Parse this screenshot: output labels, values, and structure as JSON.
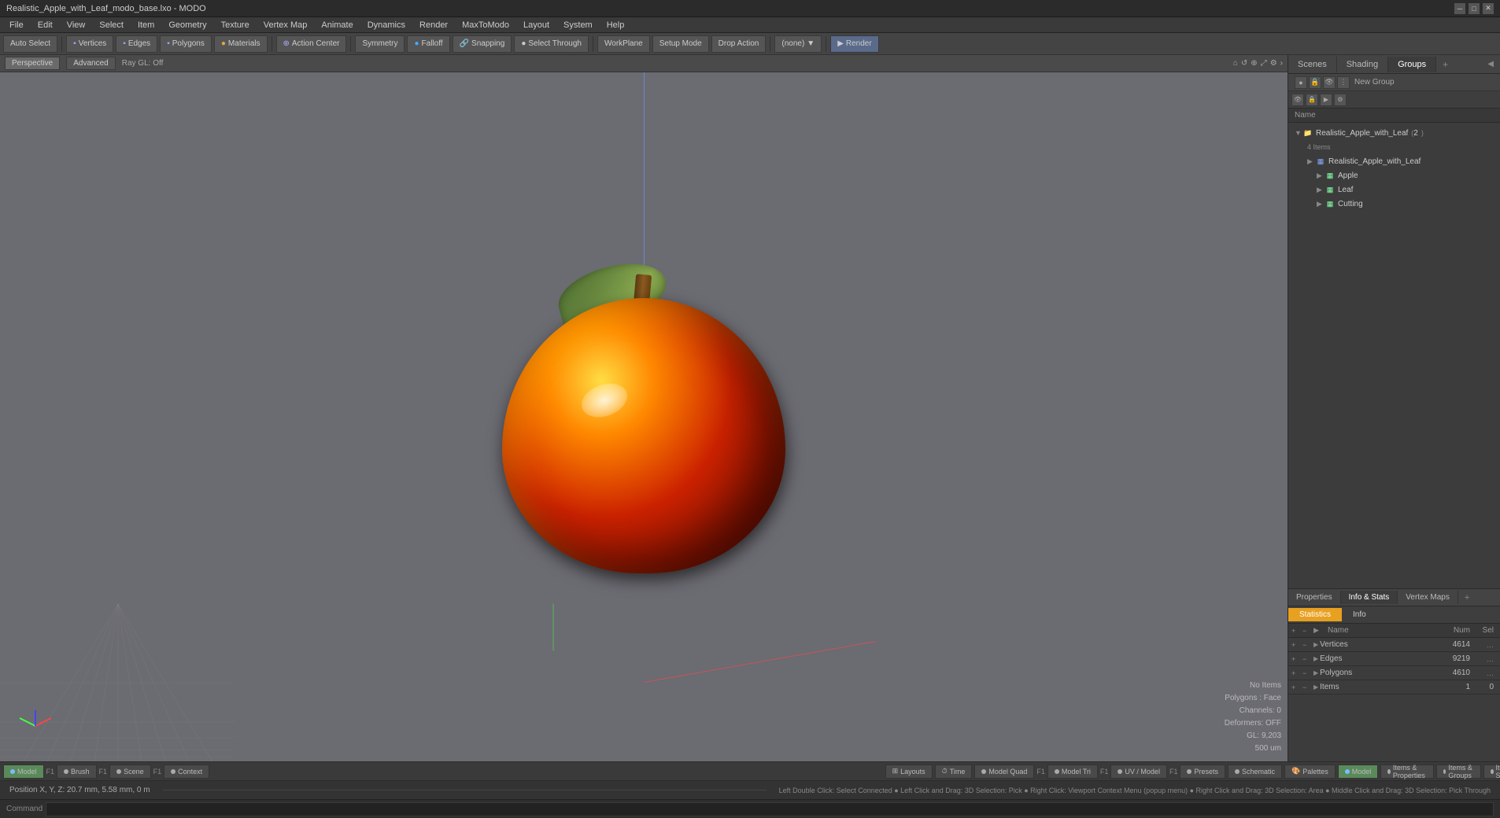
{
  "titlebar": {
    "title": "Realistic_Apple_with_Leaf_modo_base.lxo - MODO",
    "minimize_label": "─",
    "maximize_label": "□",
    "close_label": "✕"
  },
  "menubar": {
    "items": [
      "File",
      "Edit",
      "View",
      "Select",
      "Item",
      "Geometry",
      "Texture",
      "Vertex Map",
      "Animate",
      "Dynamics",
      "Render",
      "MaxToModo",
      "Layout",
      "System",
      "Help"
    ]
  },
  "toolbar": {
    "auto_select": "Auto Select",
    "vertices": "Vertices",
    "edges": "Edges",
    "polygons": "Polygons",
    "materials": "Materials",
    "action_center": "Action Center",
    "symmetry": "Symmetry",
    "falloff": "Falloff",
    "snapping": "Snapping",
    "select_through": "Select Through",
    "workplane": "WorkPlane",
    "setup_mode": "Setup Mode",
    "drop_action": "Drop Action",
    "none_label": "(none)",
    "render": "Render"
  },
  "viewport": {
    "tab_perspective": "Perspective",
    "tab_advanced": "Advanced",
    "ray_gl": "Ray GL: Off",
    "no_items": "No Items",
    "polygons_face": "Polygons : Face",
    "channels_0": "Channels: 0",
    "deformers_off": "Deformers: OFF",
    "gl_9203": "GL: 9,203",
    "size_500um": "500 um"
  },
  "right_panel": {
    "tabs": [
      "Scenes",
      "Shading",
      "Groups"
    ],
    "active_tab": "Groups",
    "add_tab_label": "+",
    "new_group_label": "New Group",
    "name_col_label": "Name",
    "tree": {
      "root_item": "Realistic_Apple_with_Leaf",
      "root_count": "2",
      "root_sub_label": "4 Items",
      "children": [
        {
          "label": "Realistic_Apple_with_Leaf",
          "indent": 1,
          "color": "#88aaff"
        },
        {
          "label": "Apple",
          "indent": 2,
          "color": "#88ffaa"
        },
        {
          "label": "Leaf",
          "indent": 2,
          "color": "#88ffaa"
        },
        {
          "label": "Cutting",
          "indent": 2,
          "color": "#88ffaa"
        }
      ]
    }
  },
  "properties": {
    "tabs": [
      "Properties",
      "Info & Stats",
      "Vertex Maps"
    ],
    "active_tab": "Info & Stats",
    "add_tab_label": "+"
  },
  "statistics": {
    "tabs": [
      "Statistics",
      "Info"
    ],
    "active_tab": "Statistics",
    "col_name": "Name",
    "col_num": "Num",
    "col_sel": "Sel",
    "rows": [
      {
        "name": "Vertices",
        "num": "4614",
        "sel": "…"
      },
      {
        "name": "Edges",
        "num": "9219",
        "sel": "…"
      },
      {
        "name": "Polygons",
        "num": "4610",
        "sel": "…"
      },
      {
        "name": "Items",
        "num": "1",
        "sel": "0"
      }
    ]
  },
  "bottom_view_tabs": {
    "left": [
      {
        "label": "Model",
        "active": true
      },
      {
        "label": "Brush"
      },
      {
        "label": "F1"
      },
      {
        "label": "Scene"
      },
      {
        "label": "F1"
      },
      {
        "label": "Context"
      }
    ],
    "center_label": "Layouts",
    "right": [
      {
        "label": "Time"
      },
      {
        "label": "Model Quad"
      },
      {
        "label": "F1"
      },
      {
        "label": "Model Tri"
      },
      {
        "label": "F1"
      },
      {
        "label": "UV / Model"
      },
      {
        "label": "F1"
      },
      {
        "label": "Presets"
      },
      {
        "label": "Schematic"
      }
    ]
  },
  "right_bottom_tabs": [
    {
      "label": "Palettes"
    },
    {
      "label": "Model",
      "active": true
    },
    {
      "label": "Items & Properties"
    },
    {
      "label": "Items & Groups"
    },
    {
      "label": "Items & Shading"
    }
  ],
  "status_bar": {
    "position": "Position X, Y, Z:  20.7 mm, 5.58 mm, 0 m"
  },
  "status_help": {
    "text": "Left Double Click: Select Connected ● Left Click and Drag: 3D Selection: Pick ● Right Click: Viewport Context Menu (popup menu) ● Right Click and Drag: 3D Selection: Area ● Middle Click and Drag: 3D Selection: Pick Through"
  },
  "command_bar": {
    "label": "Command",
    "placeholder": ""
  }
}
